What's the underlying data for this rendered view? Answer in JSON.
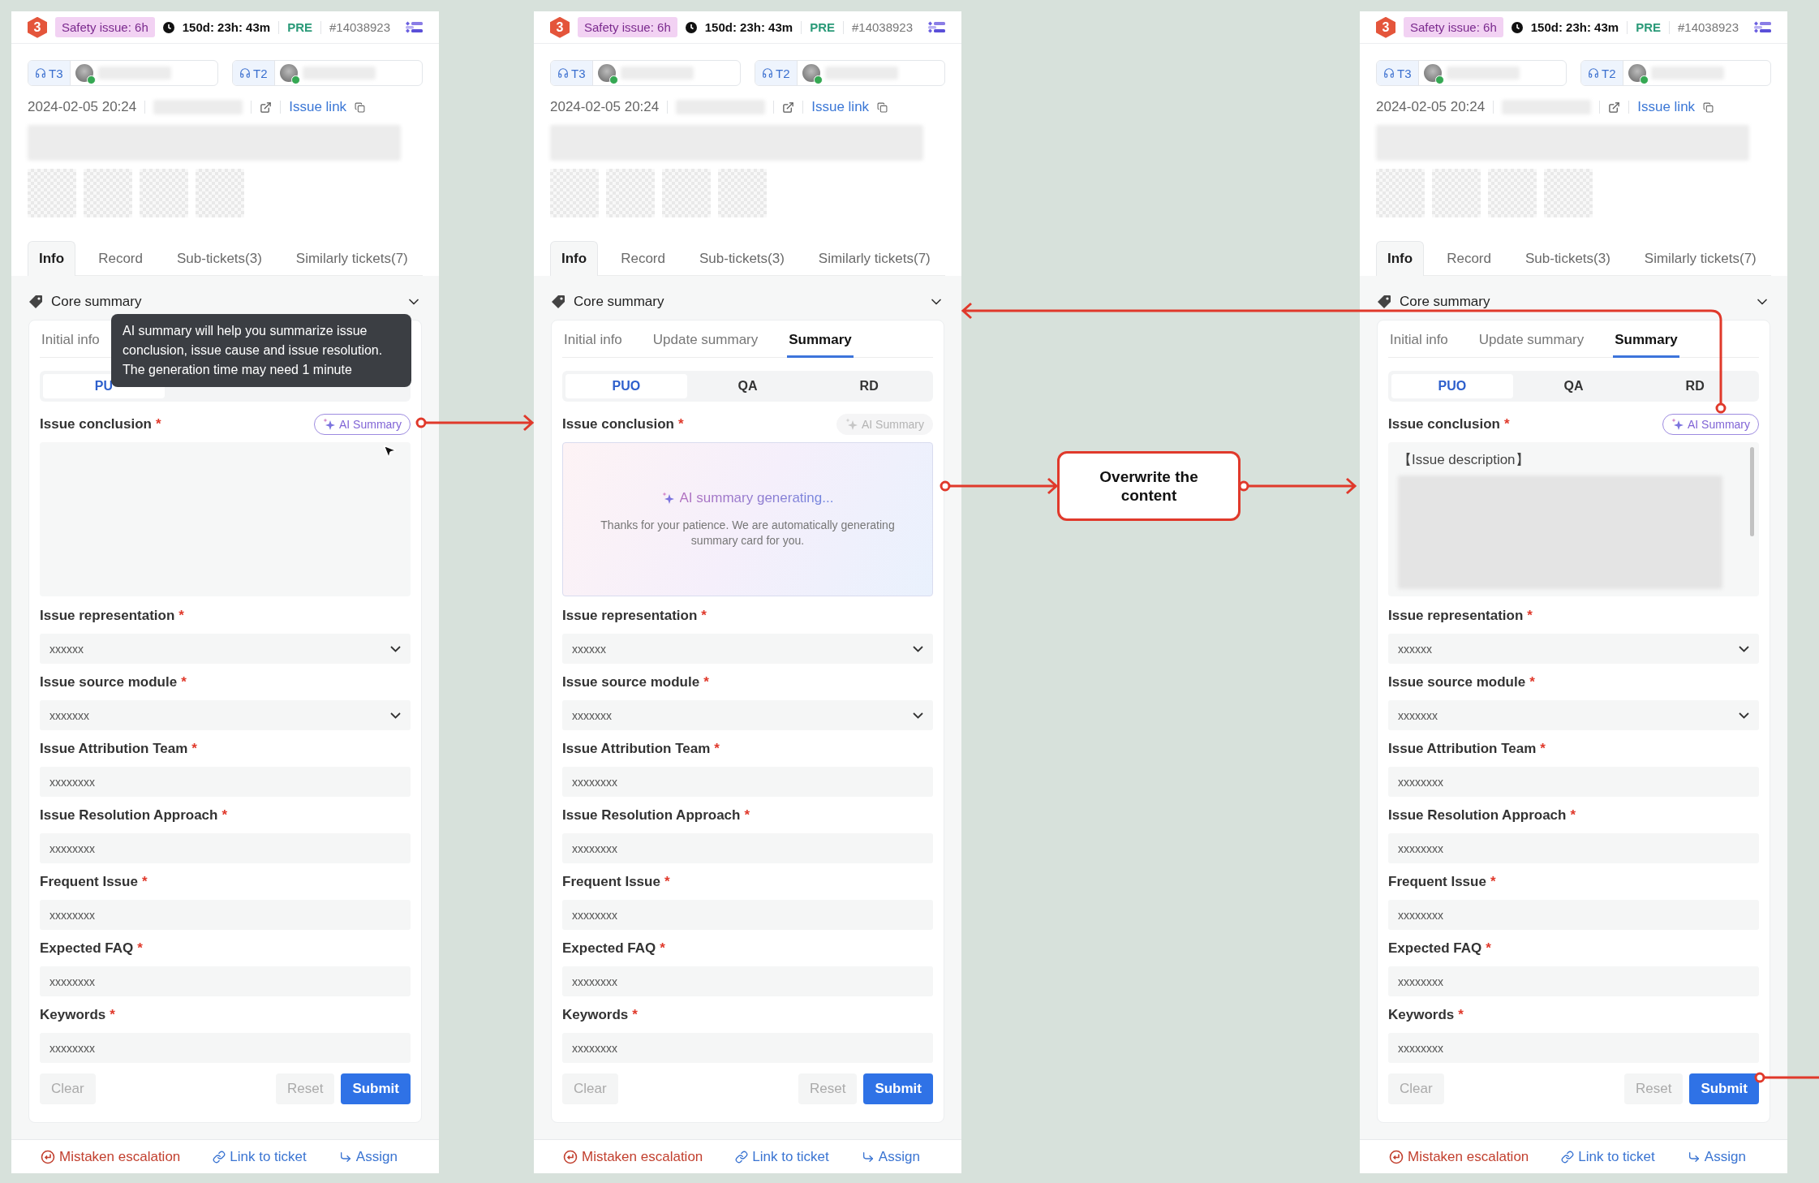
{
  "panels": [
    {
      "header": {
        "priority": "3",
        "safety": "Safety issue: 6h",
        "timer": "150d: 23h: 43m",
        "env": "PRE",
        "ticket": "#14038923"
      },
      "assignees": [
        {
          "tier": "T3"
        },
        {
          "tier": "T2"
        }
      ],
      "created": "2024-02-05 20:24",
      "issue_link": "Issue link",
      "tabs": [
        {
          "label": "Info",
          "selected": true
        },
        {
          "label": "Record",
          "selected": false
        },
        {
          "label": "Sub-tickets(3)",
          "selected": false
        },
        {
          "label": "Similarly tickets(7)",
          "selected": false
        }
      ],
      "section_title": "Core summary",
      "sub_tabs": [
        {
          "label": "Initial info",
          "selected": false
        }
      ],
      "segments": [
        {
          "label": "PU",
          "selected": true
        }
      ],
      "ai_button": {
        "label": "AI Summary",
        "disabled": false
      },
      "conclusion": {
        "label": "Issue conclusion",
        "mark": "*",
        "kind": "empty"
      },
      "fields": [
        {
          "label": "Issue representation",
          "mark": "*",
          "kind": "select",
          "value": "xxxxxx"
        },
        {
          "label": "Issue source module",
          "mark": "*",
          "kind": "select",
          "value": "xxxxxxx"
        },
        {
          "label": "Issue Attribution Team",
          "mark": "*",
          "kind": "input",
          "value": "xxxxxxxx"
        },
        {
          "label": "Issue Resolution Approach",
          "mark": "*",
          "kind": "input",
          "value": "xxxxxxxx"
        },
        {
          "label": "Frequent Issue",
          "mark": "*",
          "kind": "input",
          "value": "xxxxxxxx"
        },
        {
          "label": "Expected FAQ",
          "mark": "*",
          "kind": "input",
          "value": "xxxxxxxx"
        },
        {
          "label": "Keywords",
          "mark": "*",
          "kind": "input",
          "value": "xxxxxxxx"
        }
      ],
      "buttons": {
        "clear": "Clear",
        "reset": "Reset",
        "submit": "Submit"
      },
      "footer": [
        {
          "kind": "escalation",
          "label": "Mistaken escalation"
        },
        {
          "kind": "link",
          "label": "Link to ticket"
        },
        {
          "kind": "assign",
          "label": "Assign"
        }
      ],
      "tooltip": "AI summary will help you summarize issue conclusion, issue cause and issue resolution. The generation time may need 1 minute"
    },
    {
      "header": {
        "priority": "3",
        "safety": "Safety issue: 6h",
        "timer": "150d: 23h: 43m",
        "env": "PRE",
        "ticket": "#14038923"
      },
      "assignees": [
        {
          "tier": "T3"
        },
        {
          "tier": "T2"
        }
      ],
      "created": "2024-02-05 20:24",
      "issue_link": "Issue link",
      "tabs": [
        {
          "label": "Info",
          "selected": true
        },
        {
          "label": "Record",
          "selected": false
        },
        {
          "label": "Sub-tickets(3)",
          "selected": false
        },
        {
          "label": "Similarly tickets(7)",
          "selected": false
        }
      ],
      "section_title": "Core summary",
      "sub_tabs": [
        {
          "label": "Initial info",
          "selected": false
        },
        {
          "label": "Update summary",
          "selected": false
        },
        {
          "label": "Summary",
          "selected": true
        }
      ],
      "segments": [
        {
          "label": "PUO",
          "selected": true
        },
        {
          "label": "QA",
          "selected": false
        },
        {
          "label": "RD",
          "selected": false
        }
      ],
      "ai_button": {
        "label": "AI Summary",
        "disabled": true
      },
      "conclusion": {
        "label": "Issue conclusion",
        "mark": "*",
        "kind": "generating",
        "title": "AI summary generating...",
        "text": "Thanks for your patience. We are automatically generating summary card for you."
      },
      "fields": [
        {
          "label": "Issue representation",
          "mark": "*",
          "kind": "select",
          "value": "xxxxxx"
        },
        {
          "label": "Issue source module",
          "mark": "*",
          "kind": "select",
          "value": "xxxxxxx"
        },
        {
          "label": "Issue Attribution Team",
          "mark": "*",
          "kind": "input",
          "value": "xxxxxxxx"
        },
        {
          "label": "Issue Resolution Approach",
          "mark": "*",
          "kind": "input",
          "value": "xxxxxxxx"
        },
        {
          "label": "Frequent Issue",
          "mark": "*",
          "kind": "input",
          "value": "xxxxxxxx"
        },
        {
          "label": "Expected FAQ",
          "mark": "*",
          "kind": "input",
          "value": "xxxxxxxx"
        },
        {
          "label": "Keywords",
          "mark": "*",
          "kind": "input",
          "value": "xxxxxxxx"
        }
      ],
      "buttons": {
        "clear": "Clear",
        "reset": "Reset",
        "submit": "Submit"
      },
      "footer": [
        {
          "kind": "escalation",
          "label": "Mistaken escalation"
        },
        {
          "kind": "link",
          "label": "Link to ticket"
        },
        {
          "kind": "assign",
          "label": "Assign"
        }
      ]
    },
    {
      "header": {
        "priority": "3",
        "safety": "Safety issue: 6h",
        "timer": "150d: 23h: 43m",
        "env": "PRE",
        "ticket": "#14038923"
      },
      "assignees": [
        {
          "tier": "T3"
        },
        {
          "tier": "T2"
        }
      ],
      "created": "2024-02-05 20:24",
      "issue_link": "Issue link",
      "tabs": [
        {
          "label": "Info",
          "selected": true
        },
        {
          "label": "Record",
          "selected": false
        },
        {
          "label": "Sub-tickets(3)",
          "selected": false
        },
        {
          "label": "Similarly tickets(7)",
          "selected": false
        }
      ],
      "section_title": "Core summary",
      "sub_tabs": [
        {
          "label": "Initial info",
          "selected": false
        },
        {
          "label": "Update summary",
          "selected": false
        },
        {
          "label": "Summary",
          "selected": true
        }
      ],
      "segments": [
        {
          "label": "PUO",
          "selected": true
        },
        {
          "label": "QA",
          "selected": false
        },
        {
          "label": "RD",
          "selected": false
        }
      ],
      "ai_button": {
        "label": "AI Summary",
        "disabled": false
      },
      "conclusion": {
        "label": "Issue conclusion",
        "mark": "*",
        "kind": "text",
        "value": "【Issue description】"
      },
      "fields": [
        {
          "label": "Issue representation",
          "mark": "*",
          "kind": "select",
          "value": "xxxxxx"
        },
        {
          "label": "Issue source module",
          "mark": "*",
          "kind": "select",
          "value": "xxxxxxx"
        },
        {
          "label": "Issue Attribution Team",
          "mark": "*",
          "kind": "input",
          "value": "xxxxxxxx"
        },
        {
          "label": "Issue Resolution Approach",
          "mark": "*",
          "kind": "input",
          "value": "xxxxxxxx"
        },
        {
          "label": "Frequent Issue",
          "mark": "*",
          "kind": "input",
          "value": "xxxxxxxx"
        },
        {
          "label": "Expected FAQ",
          "mark": "*",
          "kind": "input",
          "value": "xxxxxxxx"
        },
        {
          "label": "Keywords",
          "mark": "*",
          "kind": "input",
          "value": "xxxxxxxx"
        }
      ],
      "buttons": {
        "clear": "Clear",
        "reset": "Reset",
        "submit": "Submit"
      },
      "footer": [
        {
          "kind": "escalation",
          "label": "Mistaken escalation"
        },
        {
          "kind": "link",
          "label": "Link to ticket"
        },
        {
          "kind": "assign",
          "label": "Assign"
        }
      ]
    }
  ],
  "callout": {
    "text": "Overwrite the content"
  }
}
